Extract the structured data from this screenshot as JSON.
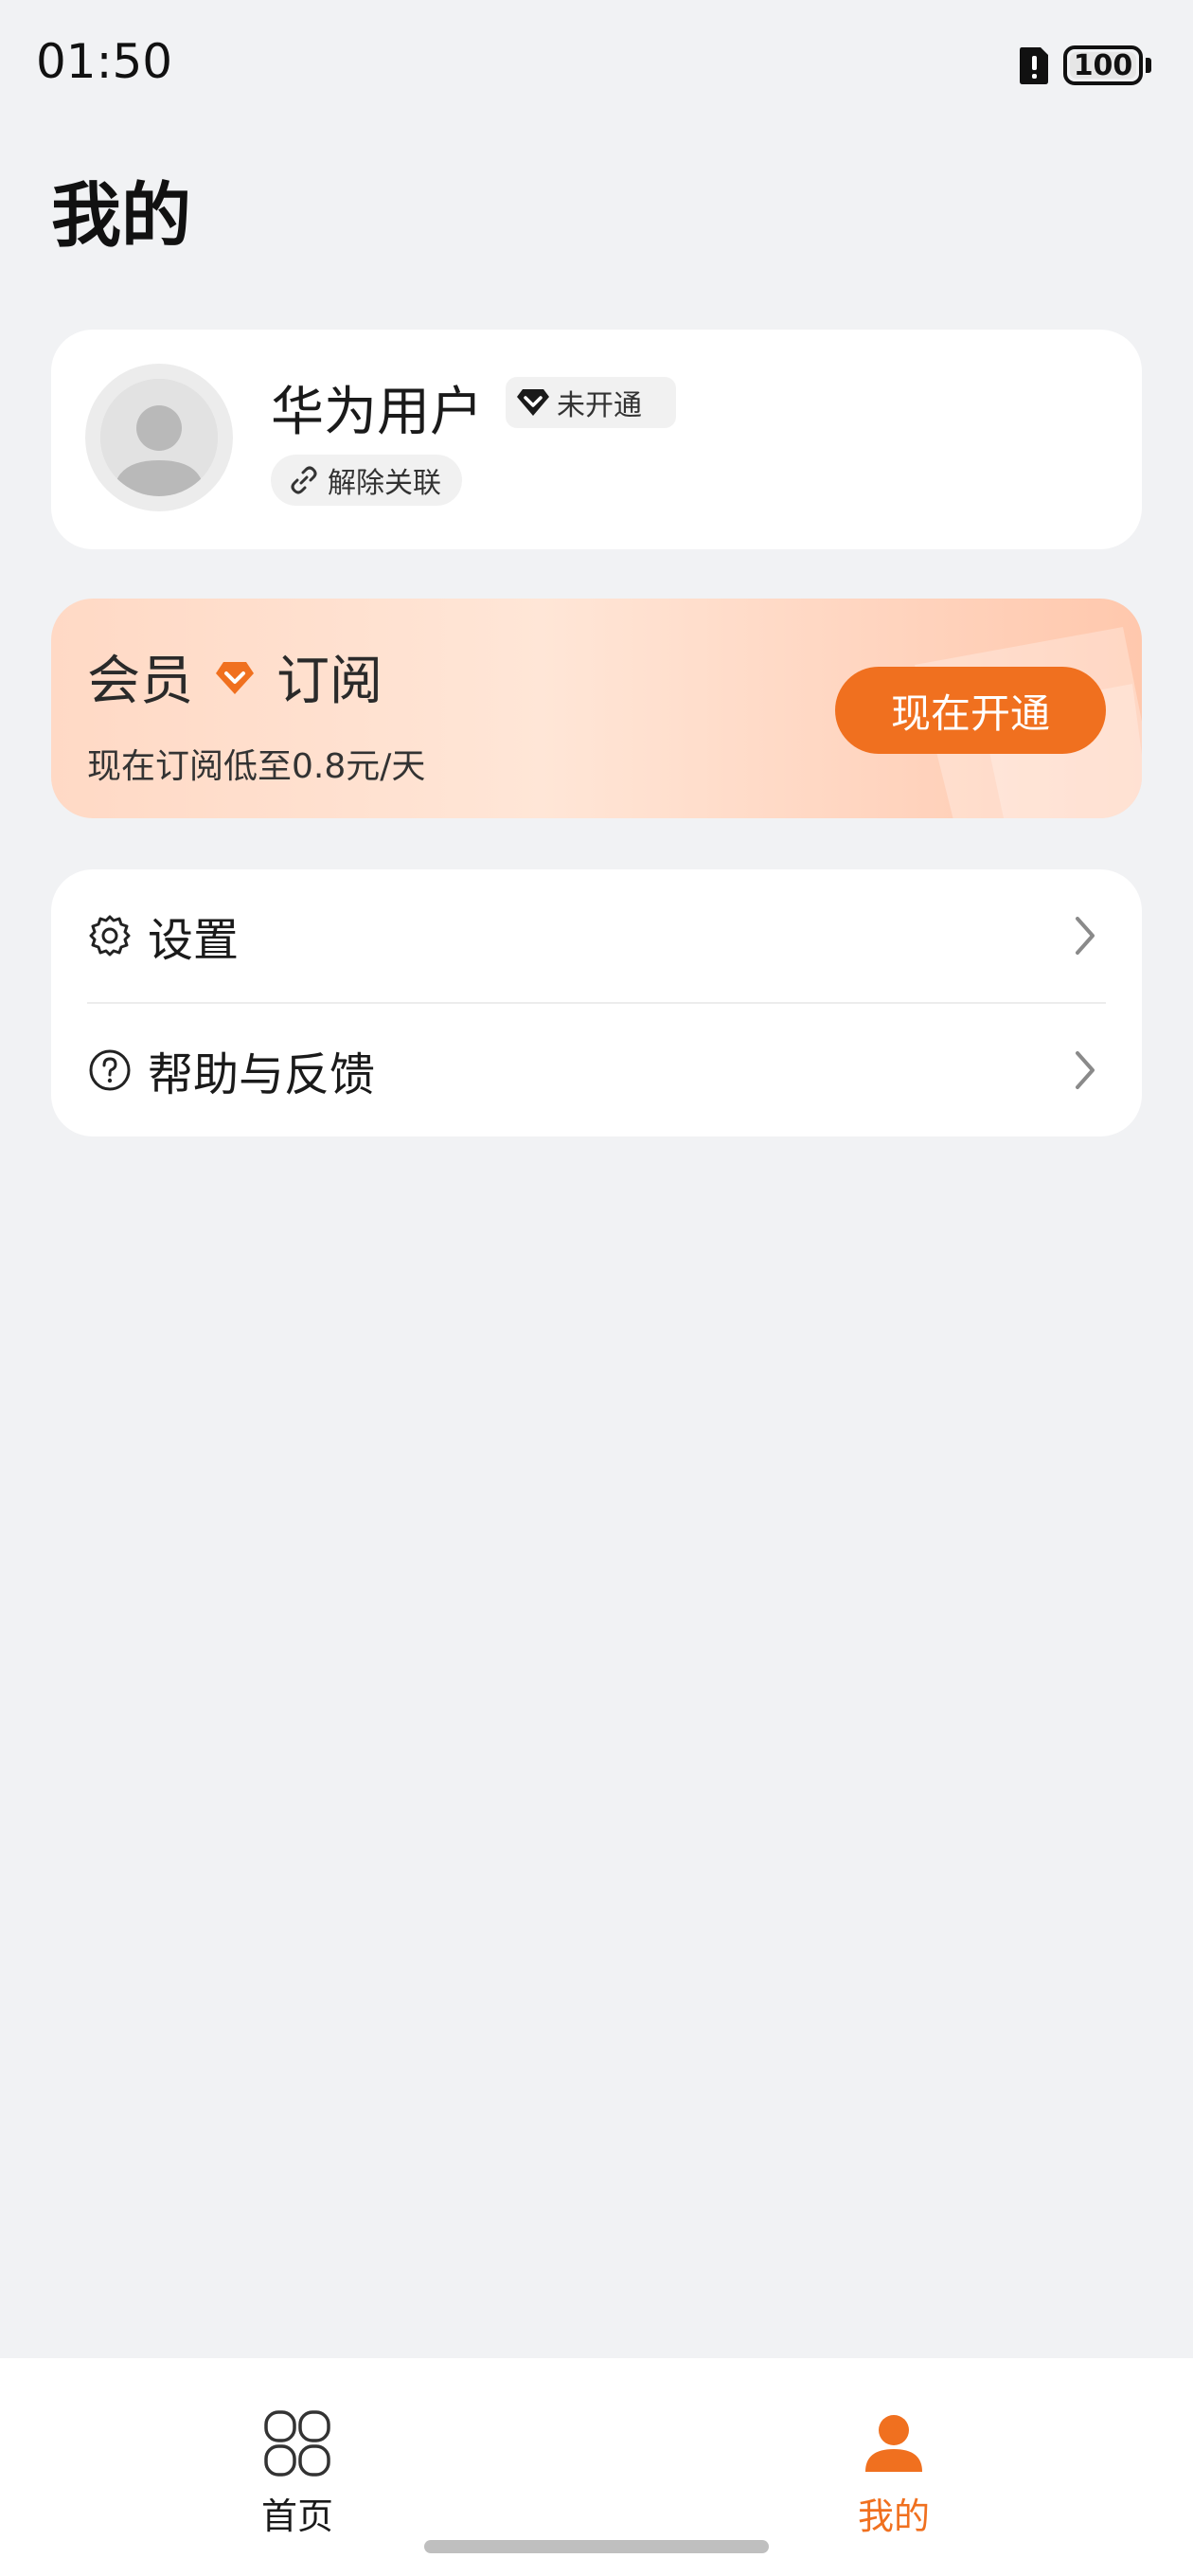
{
  "status_bar": {
    "time": "01:50",
    "battery": "100",
    "icons": [
      "sim-alert-icon",
      "battery-icon"
    ]
  },
  "page": {
    "title": "我的"
  },
  "profile": {
    "name": "华为用户",
    "member_status": "未开通",
    "unlink_label": "解除关联",
    "icons": [
      "avatar-icon",
      "diamond-icon",
      "link-icon"
    ]
  },
  "vip": {
    "title_left": "会员",
    "title_right": "订阅",
    "subtitle": "现在订阅低至0.8元/天",
    "button_label": "现在开通",
    "accent_color": "#f0701f",
    "icons": [
      "vip-gem-icon"
    ]
  },
  "menu": {
    "items": [
      {
        "label": "设置",
        "icon": "gear-icon"
      },
      {
        "label": "帮助与反馈",
        "icon": "help-icon"
      }
    ]
  },
  "tab_bar": {
    "tabs": [
      {
        "label": "首页",
        "icon": "grid-icon",
        "active": false
      },
      {
        "label": "我的",
        "icon": "person-icon",
        "active": true
      }
    ],
    "active_color": "#f0701f"
  }
}
